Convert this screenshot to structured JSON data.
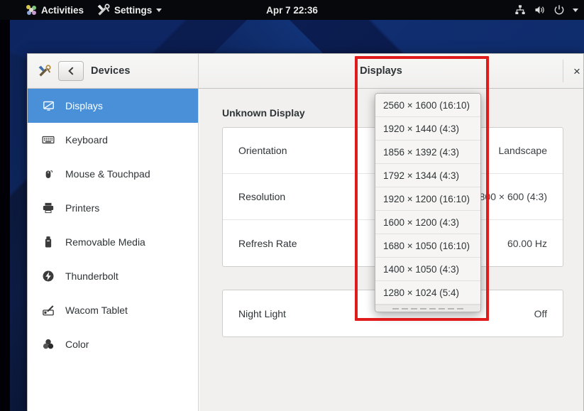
{
  "topbar": {
    "activities": "Activities",
    "app_menu": "Settings",
    "clock": "Apr 7 22:36",
    "icons": [
      "network-wired-icon",
      "volume-icon",
      "power-icon",
      "caret-down-icon"
    ]
  },
  "window": {
    "sidebar_title": "Devices",
    "content_title": "Displays",
    "back_label": "‹",
    "close_label": "×"
  },
  "sidebar": {
    "items": [
      {
        "label": "Displays",
        "icon": "display-icon",
        "selected": true
      },
      {
        "label": "Keyboard",
        "icon": "keyboard-icon",
        "selected": false
      },
      {
        "label": "Mouse & Touchpad",
        "icon": "mouse-icon",
        "selected": false
      },
      {
        "label": "Printers",
        "icon": "printer-icon",
        "selected": false
      },
      {
        "label": "Removable Media",
        "icon": "usb-drive-icon",
        "selected": false
      },
      {
        "label": "Thunderbolt",
        "icon": "thunderbolt-icon",
        "selected": false
      },
      {
        "label": "Wacom Tablet",
        "icon": "wacom-tablet-icon",
        "selected": false
      },
      {
        "label": "Color",
        "icon": "color-icon",
        "selected": false
      }
    ]
  },
  "content": {
    "display_name": "Unknown Display",
    "rows": [
      {
        "label": "Orientation",
        "value": "Landscape"
      },
      {
        "label": "Resolution",
        "value": "800 × 600 (4:3)"
      },
      {
        "label": "Refresh Rate",
        "value": "60.00 Hz"
      }
    ],
    "night_light": {
      "label": "Night Light",
      "value": "Off"
    }
  },
  "resolution_dropdown": {
    "selected": "1920 × 1200 (16:10)",
    "options": [
      "2560 × 1600 (16:10)",
      "1920 × 1440 (4:3)",
      "1856 × 1392 (4:3)",
      "1792 × 1344 (4:3)",
      "1920 × 1200 (16:10)",
      "1600 × 1200 (4:3)",
      "1680 × 1050 (16:10)",
      "1400 × 1050 (4:3)",
      "1280 × 1024 (5:4)"
    ],
    "has_more_below": true
  },
  "annotation": {
    "color": "#e01b1b",
    "shape": "rectangle"
  }
}
